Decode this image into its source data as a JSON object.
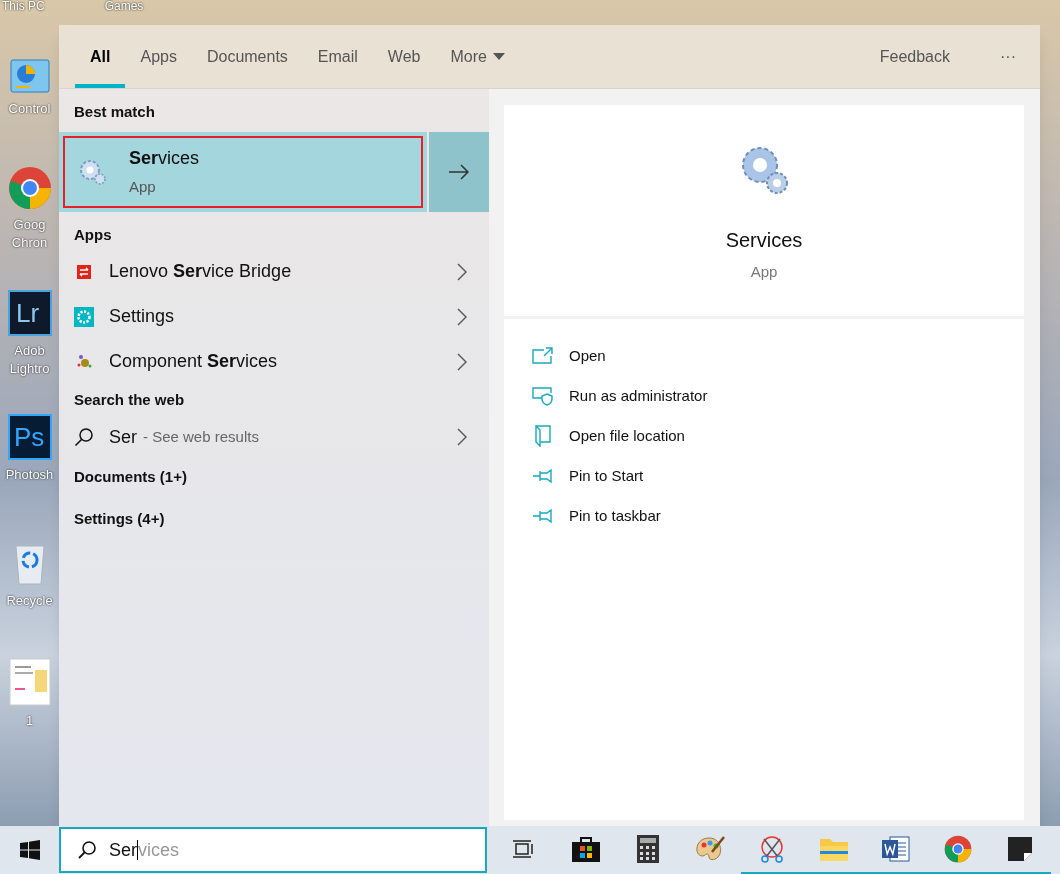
{
  "desktop_icons_top": [
    {
      "label": "This PC"
    },
    {
      "label": "Games"
    }
  ],
  "desktop_icons": [
    {
      "kind": "control-panel",
      "lines": [
        "Control"
      ]
    },
    {
      "kind": "chrome",
      "lines": [
        "Goog",
        "Chron"
      ]
    },
    {
      "kind": "lightroom",
      "logo_text": "Lr",
      "lines": [
        "Adob",
        "Lightro"
      ]
    },
    {
      "kind": "photoshop",
      "logo_text": "Ps",
      "lines": [
        "Photosh"
      ]
    },
    {
      "kind": "recycle-bin",
      "lines": [
        "Recycle"
      ]
    },
    {
      "kind": "document",
      "lines": [
        "1"
      ]
    }
  ],
  "search_panel": {
    "tabs": [
      {
        "label": "All",
        "selected": true
      },
      {
        "label": "Apps",
        "selected": false
      },
      {
        "label": "Documents",
        "selected": false
      },
      {
        "label": "Email",
        "selected": false
      },
      {
        "label": "Web",
        "selected": false
      },
      {
        "label": "More",
        "selected": false,
        "dropdown": true
      }
    ],
    "feedback": "Feedback",
    "more_options": "···",
    "best_match": {
      "heading": "Best match",
      "name": "**Ser**vices",
      "type": "App",
      "selected": true,
      "outlined": true
    },
    "apps": {
      "heading": "Apps",
      "items": [
        {
          "kind": "lenovo",
          "name": "Lenovo **Ser**vice Bridge"
        },
        {
          "kind": "settings",
          "name": "Settings"
        },
        {
          "kind": "component",
          "name": "Component **Ser**vices"
        }
      ]
    },
    "web": {
      "heading": "Search the web",
      "query": "Ser",
      "hint": "- See web results"
    },
    "more_sections": [
      "Documents (1+)",
      "Settings (4+)"
    ],
    "preview": {
      "name": "Services",
      "type": "App",
      "actions": [
        {
          "kind": "open",
          "label": "Open"
        },
        {
          "kind": "admin",
          "label": "Run as administrator"
        },
        {
          "kind": "location",
          "label": "Open file location"
        },
        {
          "kind": "pin",
          "label": "Pin to Start"
        },
        {
          "kind": "pin",
          "label": "Pin to taskbar"
        }
      ]
    }
  },
  "taskbar": {
    "search": {
      "value": "Ser",
      "suggestion": "vices"
    },
    "apps": [
      {
        "kind": "task-view",
        "running": false
      },
      {
        "kind": "store",
        "running": false
      },
      {
        "kind": "calculator",
        "running": false
      },
      {
        "kind": "paint",
        "running": false
      },
      {
        "kind": "snipping",
        "running": true
      },
      {
        "kind": "explorer",
        "running": true
      },
      {
        "kind": "word",
        "running": true
      },
      {
        "kind": "chrome",
        "running": true
      },
      {
        "kind": "sticky",
        "running": true
      }
    ]
  }
}
